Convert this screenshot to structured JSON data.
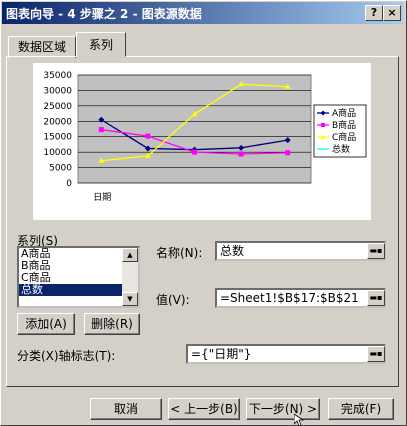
{
  "window": {
    "title": "图表向导 - 4 步骤之 2 - 图表源数据",
    "help_label": "?",
    "close_label": "×"
  },
  "tabs": [
    {
      "label": "数据区域"
    },
    {
      "label": "系列"
    }
  ],
  "chart_data": {
    "type": "line",
    "categories": [
      "日期",
      "",
      "",
      "",
      ""
    ],
    "ylim": [
      0,
      35000
    ],
    "yticks": [
      "35000",
      "30000",
      "25000",
      "20000",
      "15000",
      "10000",
      "5000",
      "0"
    ],
    "series": [
      {
        "name": "A商品",
        "color": "#000080",
        "marker": "diamond",
        "values": [
          20500,
          11200,
          10800,
          11400,
          13900
        ]
      },
      {
        "name": "B商品",
        "color": "#ff00ff",
        "marker": "square",
        "values": [
          17300,
          15200,
          10000,
          9400,
          9800
        ]
      },
      {
        "name": "C商品",
        "color": "#ffff00",
        "marker": "triangle",
        "values": [
          7200,
          8800,
          22300,
          32000,
          31200
        ]
      },
      {
        "name": "总数",
        "color": "#00ffff",
        "marker": "x",
        "values": [
          null,
          null,
          null,
          null,
          null
        ]
      }
    ]
  },
  "series_panel": {
    "label": "系列(S)",
    "items": [
      "A商品",
      "B商品",
      "C商品",
      "总数"
    ],
    "selected_index": 3,
    "add_label": "添加(A)",
    "delete_label": "删除(R)"
  },
  "name_field": {
    "label": "名称(N):",
    "value": "总数"
  },
  "value_field": {
    "label": "值(V):",
    "value": "=Sheet1!$B$17:$B$21"
  },
  "category_field": {
    "label": "分类(X)轴标志(T):",
    "value": "={\"日期\"}"
  },
  "buttons": {
    "cancel": "取消",
    "back": "< 上一步(B)",
    "next": "下一步(N) >",
    "finish": "完成(F)"
  }
}
